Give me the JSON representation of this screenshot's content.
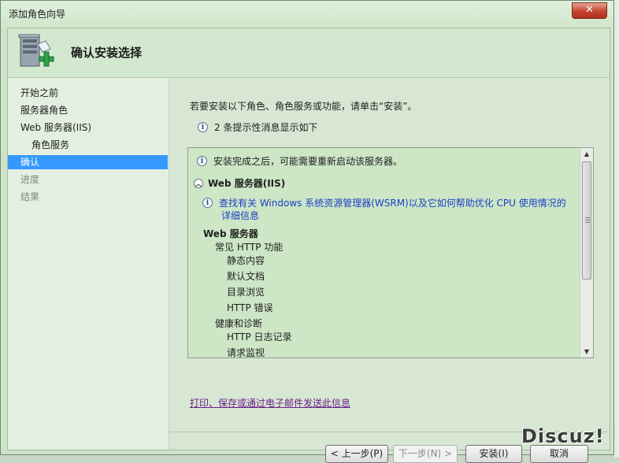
{
  "window": {
    "title": "添加角色向导",
    "close_glyph": "✕"
  },
  "header": {
    "title": "确认安装选择",
    "icon": "server-add-icon"
  },
  "sidebar": {
    "items": [
      {
        "label": "开始之前",
        "state": "normal"
      },
      {
        "label": "服务器角色",
        "state": "normal"
      },
      {
        "label": "Web 服务器(IIS)",
        "state": "normal"
      },
      {
        "label": "角色服务",
        "state": "sub"
      },
      {
        "label": "确认",
        "state": "selected"
      },
      {
        "label": "进度",
        "state": "dim"
      },
      {
        "label": "结果",
        "state": "dim"
      }
    ]
  },
  "main": {
    "intro": "若要安装以下角色、角色服务或功能，请单击“安装”。",
    "info_message": "2 条提示性消息显示如下",
    "list": {
      "restart_note": "安装完成之后，可能需要重新启动该服务器。",
      "section_title": "Web 服务器(IIS)",
      "wsrm_link_line1": "查找有关 Windows 系统资源管理器(WSRM)以及它如何帮助优化 CPU 使用情况的",
      "wsrm_link_line2": "详细信息",
      "group": "Web 服务器",
      "common_http": "常见 HTTP 功能",
      "static_content": "静态内容",
      "default_doc": "默认文档",
      "dir_browse": "目录浏览",
      "http_errors": "HTTP 错误",
      "health": "健康和诊断",
      "http_logging": "HTTP 日志记录",
      "request_monitor": "请求监视"
    },
    "print_link": "打印、保存或通过电子邮件发送此信息"
  },
  "buttons": {
    "prev": "< 上一步(P)",
    "next": "下一步(N) >",
    "install": "安装(I)",
    "cancel": "取消"
  },
  "watermark": "Discuz!"
}
